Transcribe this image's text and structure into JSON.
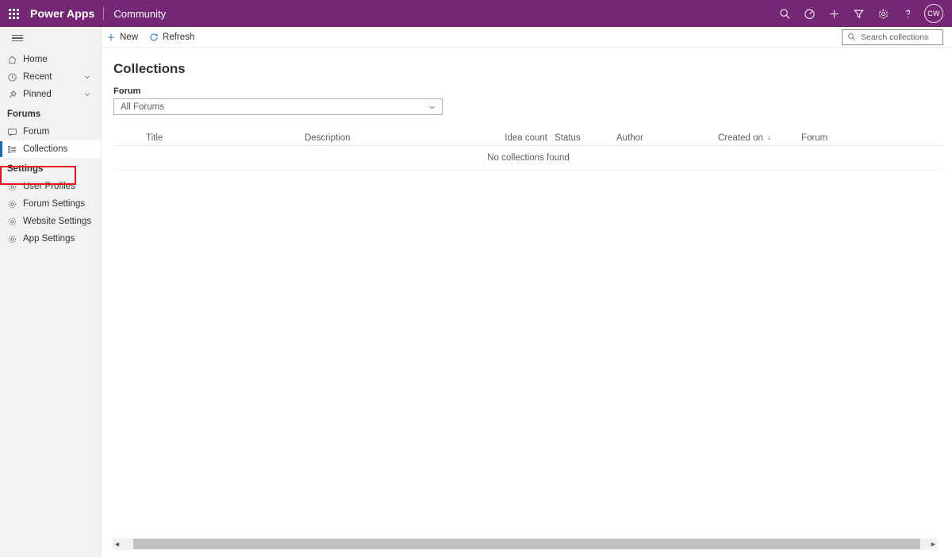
{
  "topbar": {
    "waffle_label": "app-launcher",
    "brand": "Power Apps",
    "app_name": "Community",
    "brand_color": "#742774",
    "icons": [
      {
        "name": "search-icon",
        "label": "Search"
      },
      {
        "name": "trial-clock-icon",
        "label": "Trial"
      },
      {
        "name": "plus-icon",
        "label": "New"
      },
      {
        "name": "filter-icon",
        "label": "Filter"
      },
      {
        "name": "gear-icon",
        "label": "Settings"
      },
      {
        "name": "help-icon",
        "label": "Help"
      }
    ],
    "avatar_initials": "CW"
  },
  "sidebar": {
    "hamburger_label": "Collapse navigation",
    "items": [
      {
        "label": "Home",
        "icon": "home-icon",
        "chevron": false
      },
      {
        "label": "Recent",
        "icon": "clock-icon",
        "chevron": true
      },
      {
        "label": "Pinned",
        "icon": "pin-icon",
        "chevron": true
      }
    ],
    "group_forums": "Forums",
    "forum_items": [
      {
        "label": "Forum",
        "icon": "chat-icon",
        "selected": false
      },
      {
        "label": "Collections",
        "icon": "list-icon",
        "selected": true
      }
    ],
    "group_settings": "Settings",
    "settings_items": [
      {
        "label": "User Profiles",
        "icon": "gear-icon"
      },
      {
        "label": "Forum Settings",
        "icon": "gear-icon"
      },
      {
        "label": "Website Settings",
        "icon": "gear-icon"
      },
      {
        "label": "App Settings",
        "icon": "gear-icon"
      }
    ],
    "highlight_color": "#e81123",
    "selected_indicator_color": "#0f6cbd"
  },
  "commandbar": {
    "new_label": "New",
    "refresh_label": "Refresh",
    "search_placeholder": "Search collections",
    "search_value": ""
  },
  "main": {
    "page_title": "Collections",
    "filter_label": "Forum",
    "filter_value": "All Forums",
    "columns": [
      {
        "key": "title",
        "label": "Title",
        "sorted": false
      },
      {
        "key": "description",
        "label": "Description",
        "sorted": false
      },
      {
        "key": "idea_count",
        "label": "Idea count",
        "sorted": false
      },
      {
        "key": "status",
        "label": "Status",
        "sorted": false
      },
      {
        "key": "author",
        "label": "Author",
        "sorted": false
      },
      {
        "key": "created_on",
        "label": "Created on",
        "sorted": true,
        "sort_glyph": "↓"
      },
      {
        "key": "forum",
        "label": "Forum",
        "sorted": false
      }
    ],
    "rows": [],
    "empty_message": "No collections found"
  },
  "scrollbar": {
    "left_arrow": "◀",
    "right_arrow": "▶"
  }
}
